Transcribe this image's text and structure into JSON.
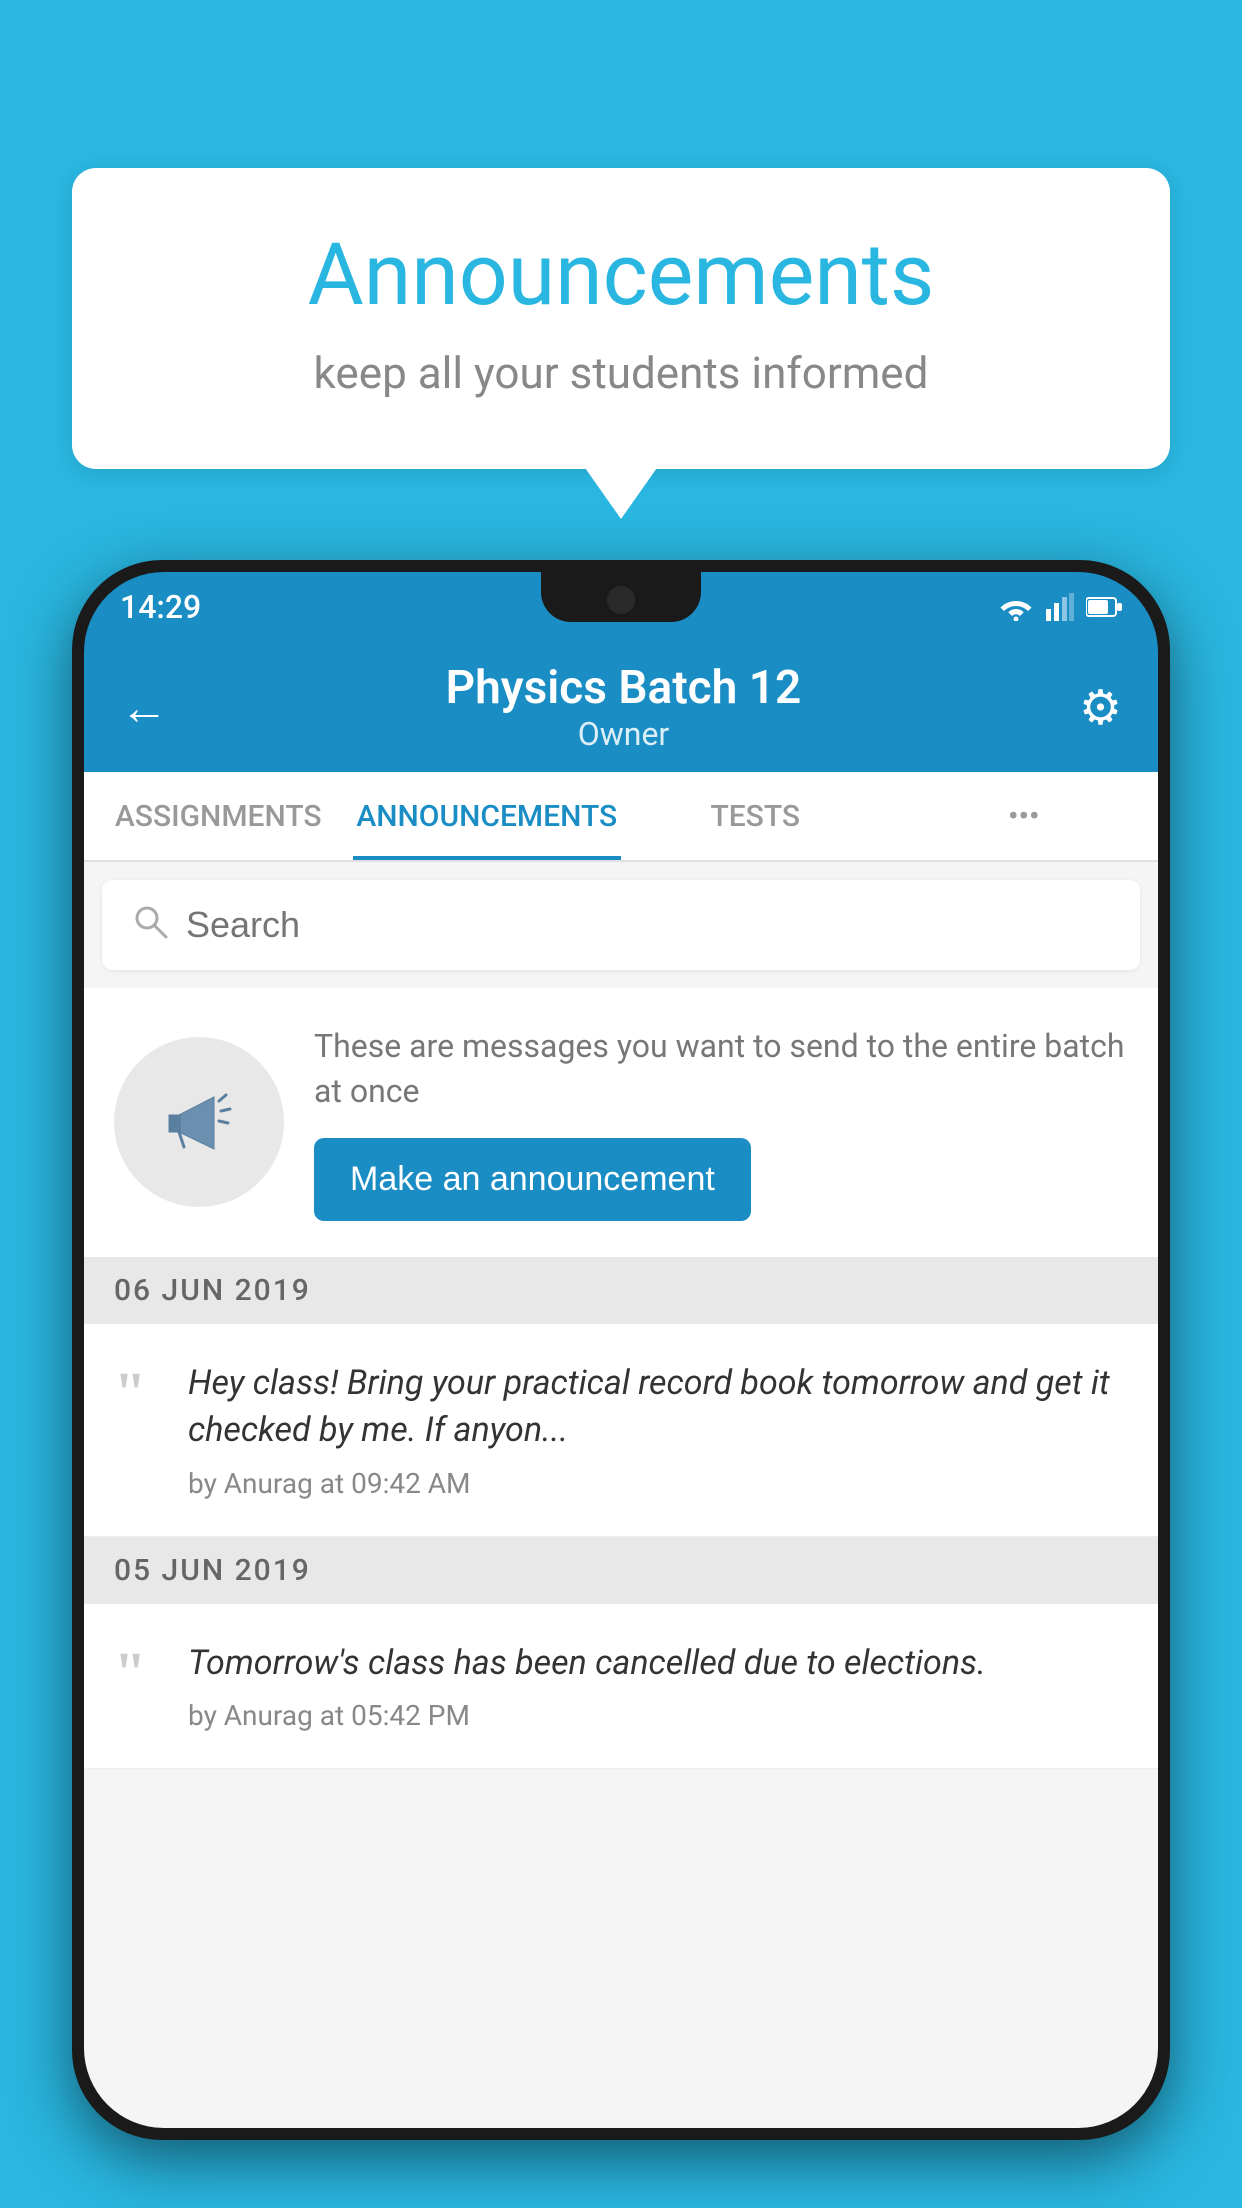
{
  "background_color": "#29B6E0",
  "speech_bubble": {
    "title": "Announcements",
    "subtitle": "keep all your students informed"
  },
  "status_bar": {
    "time": "14:29"
  },
  "app_header": {
    "title": "Physics Batch 12",
    "subtitle": "Owner",
    "back_icon": "←",
    "gear_icon": "⚙"
  },
  "tabs": [
    {
      "label": "ASSIGNMENTS",
      "active": false
    },
    {
      "label": "ANNOUNCEMENTS",
      "active": true
    },
    {
      "label": "TESTS",
      "active": false
    },
    {
      "label": "•••",
      "active": false
    }
  ],
  "search": {
    "placeholder": "Search"
  },
  "promo": {
    "description_text": "These are messages you want to send to the entire batch at once",
    "button_label": "Make an announcement"
  },
  "announcements": [
    {
      "date": "06  JUN  2019",
      "text": "Hey class! Bring your practical record book tomorrow and get it checked by me. If anyon...",
      "author": "by Anurag at 09:42 AM"
    },
    {
      "date": "05  JUN  2019",
      "text": "Tomorrow's class has been cancelled due to elections.",
      "author": "by Anurag at 05:42 PM"
    }
  ]
}
